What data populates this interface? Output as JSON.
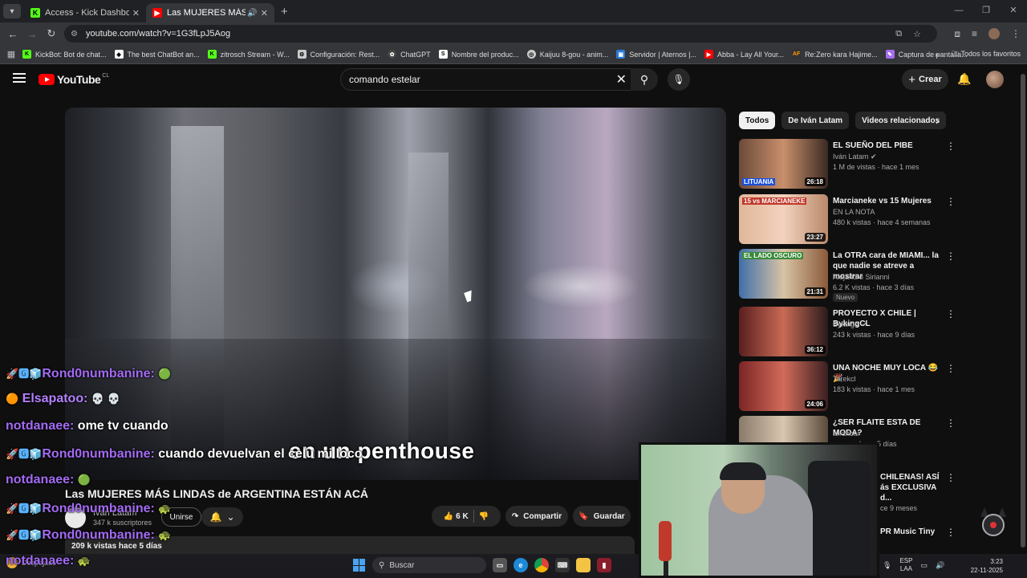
{
  "browser": {
    "tabs": [
      {
        "title": "Access - Kick Dashboard",
        "icon": "kick-icon",
        "active": false
      },
      {
        "title": "Las MUJERES MÁS LINDAS",
        "icon": "youtube-icon",
        "active": true
      }
    ],
    "url": "youtube.com/watch?v=1G3fLpJ5Aog",
    "bookmarks": [
      {
        "label": "KickBot: Bot de chat...",
        "icon": "kick-icon",
        "color": "#53fc18"
      },
      {
        "label": "The best ChatBot an...",
        "icon": "shield-icon",
        "color": "#ffffff"
      },
      {
        "label": "zitrosch Stream - W...",
        "icon": "kick-icon",
        "color": "#53fc18"
      },
      {
        "label": "Configuración: Rest...",
        "icon": "gear-icon",
        "color": "#cccccc"
      },
      {
        "label": "ChatGPT",
        "icon": "chatgpt-icon",
        "color": "#444444"
      },
      {
        "label": "Nombre del produc...",
        "icon": "s-icon",
        "color": "#ffffff"
      },
      {
        "label": "Kaijuu 8-gou - anim...",
        "icon": "globe-icon",
        "color": "#cccccc"
      },
      {
        "label": "Servidor | Aternos |...",
        "icon": "aternos-icon",
        "color": "#2b7bd6"
      },
      {
        "label": "Abba - Lay All Your...",
        "icon": "youtube-icon",
        "color": "#ff0000"
      },
      {
        "label": "Re:Zero kara Hajime...",
        "icon": "af-icon",
        "color": "#333333"
      },
      {
        "label": "Captura de pantalla...",
        "icon": "feather-icon",
        "color": "#a56df0"
      }
    ],
    "all_favorites": "Todos los favoritos"
  },
  "youtube": {
    "region": "CL",
    "logo_text": "YouTube",
    "search_query": "comando estelar",
    "create_label": "Crear"
  },
  "video": {
    "caption": "en un penthouse",
    "title": "Las MUJERES MÁS LINDAS de ARGENTINA ESTÁN ACÁ",
    "channel": "Iván Latam",
    "subscribers": "347 k suscriptores",
    "join_label": "Unirse",
    "likes": "6 K",
    "share_label": "Compartir",
    "save_label": "Guardar",
    "meta": "209 k vistas  hace 5 días"
  },
  "chips": [
    "Todos",
    "De Iván Latam",
    "Videos relacionados"
  ],
  "recommendations": [
    {
      "title": "EL SUEÑO DEL PIBE",
      "channel": "Iván Latam",
      "verified": true,
      "meta": "1 M de vistas · hace 1 mes",
      "duration": "26:18",
      "thumb_label": "LITUANIA",
      "thumb_bg": "linear-gradient(90deg,#6b4a3a,#c98f6b,#3b2a22)"
    },
    {
      "title": "Marcianeke vs 15 Mujeres",
      "channel": "EN LA NOTA",
      "verified": false,
      "meta": "480 k vistas · hace 4 semanas",
      "duration": "23:27",
      "thumb_label": "15 vs MARCIANEKE",
      "thumb_bg": "linear-gradient(90deg,#e0b79a,#f2d2be,#b9896a)"
    },
    {
      "title": "La OTRA cara de MIAMI... la que nadie se atreve a mostrar",
      "channel": "Alejandro Sirianni",
      "verified": false,
      "meta": "6.2 K vistas · hace 3 días",
      "duration": "21:31",
      "badge": "Nuevo",
      "thumb_label": "EL LADO OSCURO",
      "thumb_bg": "linear-gradient(90deg,#3f6fa8,#d8c3a5,#8a5a3a)"
    },
    {
      "title": "PROYECTO X CHILE | BykingCL",
      "channel": "Bykingcl",
      "verified": true,
      "meta": "243 k vistas · hace 9 días",
      "duration": "36:12",
      "thumb_label": "",
      "thumb_bg": "linear-gradient(90deg,#5a1f1f,#c86a55,#2a1a1a)"
    },
    {
      "title": "UNA NOCHE MUY LOCA 😂🎉",
      "channel": "Tarekcl",
      "verified": false,
      "meta": "183 k vistas · hace 1 mes",
      "duration": "24:06",
      "thumb_label": "",
      "thumb_bg": "linear-gradient(90deg,#7a2525,#d26b5a,#3a2020)"
    },
    {
      "title": "¿SER FLAITE ESTA DE MODA?",
      "channel": "arrancar",
      "verified": false,
      "meta": "hace 5 días",
      "duration": "",
      "thumb_label": "",
      "thumb_bg": "linear-gradient(90deg,#8a7a6a,#d9c6b0,#5a4a3a)"
    },
    {
      "title": "CHILENAS! ASÍ ás EXCLUSIVA d...",
      "channel": "",
      "verified": false,
      "meta": "ce 9 meses",
      "duration": "",
      "thumb_label": "",
      "thumb_bg": "#1b1b1b"
    },
    {
      "title": "PR Music Tiny",
      "channel": "",
      "verified": false,
      "meta": "",
      "duration": "",
      "thumb_label": "",
      "thumb_bg": "#1b1b1b"
    }
  ],
  "chat": [
    {
      "badges": "🚀🅶🧊",
      "user": "Rond0numbanine:",
      "message": "",
      "emote": "🟢"
    },
    {
      "badges": "🟠",
      "user": "Elsapatoo:",
      "message": "",
      "emote": "💀 💀"
    },
    {
      "badges": "",
      "user": "notdanaee:",
      "message": "ome tv cuando",
      "emote": ""
    },
    {
      "badges": "🚀🅶🧊",
      "user": "Rond0numbanine:",
      "message": "cuando devuelvan el celu mi loco",
      "emote": ""
    },
    {
      "badges": "",
      "user": "notdanaee:",
      "message": "",
      "emote": "🟢"
    },
    {
      "badges": "🚀🅶🧊",
      "user": "Rond0numbanine:",
      "message": "",
      "emote": "🐢"
    },
    {
      "badges": "🚀🅶🧊",
      "user": "Rond0numbanine:",
      "message": "",
      "emote": "🐢"
    },
    {
      "badges": "",
      "user": "notdanaee:",
      "message": "",
      "emote": "🐢"
    }
  ],
  "taskbar": {
    "weather": "Despejado",
    "search_placeholder": "Buscar",
    "lang_top": "ESP",
    "lang_bottom": "LAA",
    "time": "3:23",
    "date": "22-11-2025"
  }
}
